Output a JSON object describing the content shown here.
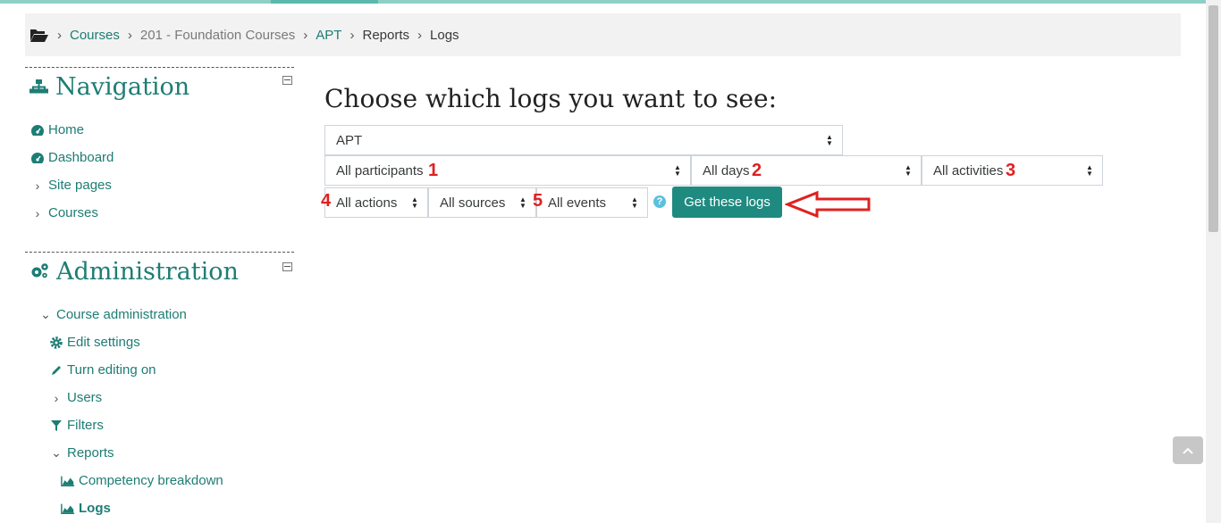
{
  "breadcrumb": {
    "items": [
      "Courses",
      "201 - Foundation Courses",
      "APT",
      "Reports",
      "Logs"
    ]
  },
  "navigation": {
    "title": "Navigation",
    "items": [
      {
        "label": "Home",
        "icon": "dashboard-icon"
      },
      {
        "label": "Dashboard",
        "icon": "dashboard-icon"
      },
      {
        "label": "Site pages",
        "icon": "chevron-right-icon"
      },
      {
        "label": "Courses",
        "icon": "chevron-right-icon"
      }
    ]
  },
  "administration": {
    "title": "Administration",
    "course_admin_label": "Course administration",
    "items": [
      {
        "label": "Edit settings",
        "icon": "gear-icon"
      },
      {
        "label": "Turn editing on",
        "icon": "pencil-icon"
      },
      {
        "label": "Users",
        "icon": "chevron-right-icon"
      },
      {
        "label": "Filters",
        "icon": "filter-icon"
      },
      {
        "label": "Reports",
        "icon": "chevron-down-icon"
      },
      {
        "label": "Competency breakdown",
        "icon": "area-chart-icon"
      },
      {
        "label": "Logs",
        "icon": "area-chart-icon"
      }
    ]
  },
  "main": {
    "title": "Choose which logs you want to see:",
    "course_select": "APT",
    "participants_select": "All participants",
    "days_select": "All days",
    "activities_select": "All activities",
    "actions_select": "All actions",
    "sources_select": "All sources",
    "events_select": "All events",
    "submit_label": "Get these logs",
    "help_glyph": "?"
  },
  "annotations": {
    "n1": "1",
    "n2": "2",
    "n3": "3",
    "n4": "4",
    "n5": "5",
    "color": "#e02020"
  },
  "colors": {
    "accent": "#1d7d74",
    "button": "#1f8a80"
  }
}
